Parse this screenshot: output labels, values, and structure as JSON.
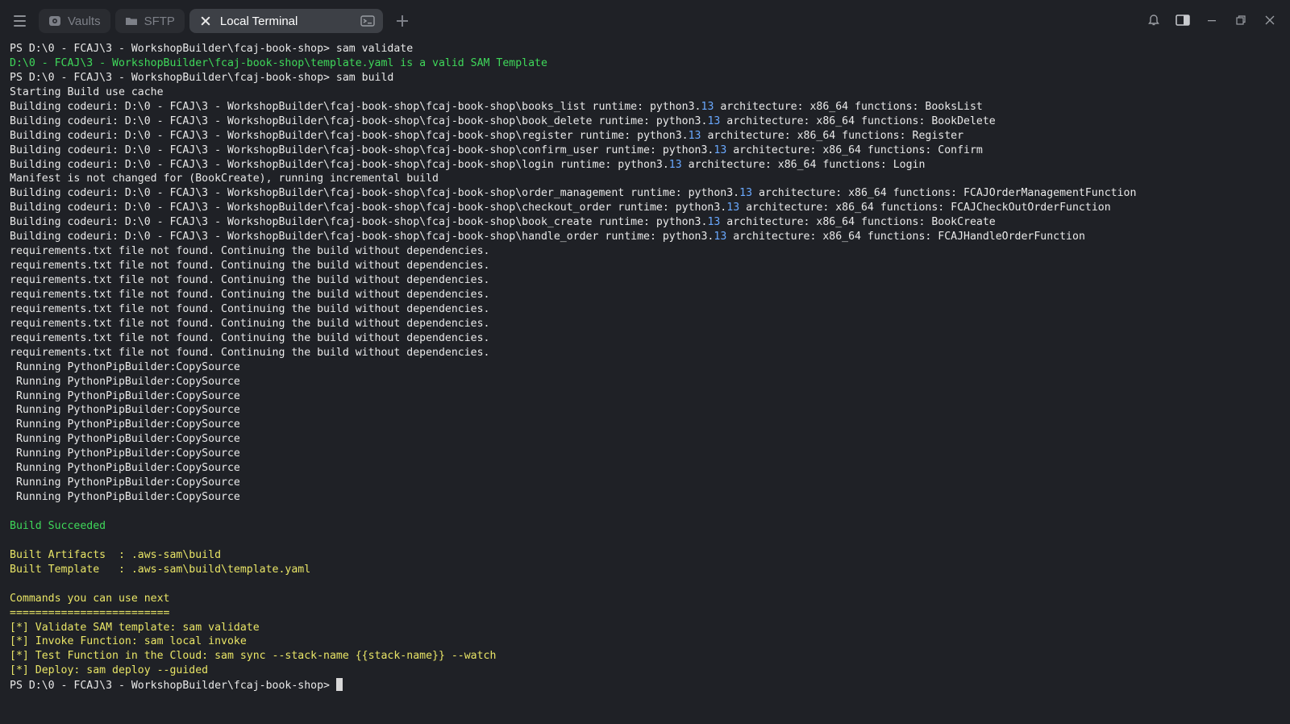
{
  "titlebar": {
    "tabs": [
      {
        "label": "Vaults",
        "icon": "vault-icon"
      },
      {
        "label": "SFTP",
        "icon": "folder-icon"
      },
      {
        "label": "Local Terminal",
        "icon": "terminal-icon",
        "active": true
      }
    ],
    "tools": [
      "bell-icon",
      "sidebar-toggle-icon",
      "minimize-icon",
      "restore-icon",
      "close-icon"
    ]
  },
  "colors": {
    "background": "#1f2126",
    "green": "#3fd85a",
    "yellow": "#e9e566",
    "number": "#6aa9ff"
  },
  "terminal": {
    "lines": [
      {
        "color": "default",
        "text": "PS D:\\0 - FCAJ\\3 - WorkshopBuilder\\fcaj-book-shop> sam validate"
      },
      {
        "color": "green",
        "text": "D:\\0 - FCAJ\\3 - WorkshopBuilder\\fcaj-book-shop\\template.yaml is a valid SAM Template"
      },
      {
        "color": "default",
        "text": "PS D:\\0 - FCAJ\\3 - WorkshopBuilder\\fcaj-book-shop> sam build"
      },
      {
        "color": "default",
        "text": "Starting Build use cache"
      },
      {
        "color": "default",
        "text": "Building codeuri: D:\\0 - FCAJ\\3 - WorkshopBuilder\\fcaj-book-shop\\fcaj-book-shop\\books_list runtime: python3.13 architecture: x86_64 functions: BooksList"
      },
      {
        "color": "default",
        "text": "Building codeuri: D:\\0 - FCAJ\\3 - WorkshopBuilder\\fcaj-book-shop\\fcaj-book-shop\\book_delete runtime: python3.13 architecture: x86_64 functions: BookDelete"
      },
      {
        "color": "default",
        "text": "Building codeuri: D:\\0 - FCAJ\\3 - WorkshopBuilder\\fcaj-book-shop\\fcaj-book-shop\\register runtime: python3.13 architecture: x86_64 functions: Register"
      },
      {
        "color": "default",
        "text": "Building codeuri: D:\\0 - FCAJ\\3 - WorkshopBuilder\\fcaj-book-shop\\fcaj-book-shop\\confirm_user runtime: python3.13 architecture: x86_64 functions: Confirm"
      },
      {
        "color": "default",
        "text": "Building codeuri: D:\\0 - FCAJ\\3 - WorkshopBuilder\\fcaj-book-shop\\fcaj-book-shop\\login runtime: python3.13 architecture: x86_64 functions: Login"
      },
      {
        "color": "default",
        "text": "Manifest is not changed for (BookCreate), running incremental build"
      },
      {
        "color": "default",
        "text": "Building codeuri: D:\\0 - FCAJ\\3 - WorkshopBuilder\\fcaj-book-shop\\fcaj-book-shop\\order_management runtime: python3.13 architecture: x86_64 functions: FCAJOrderManagementFunction"
      },
      {
        "color": "default",
        "text": "Building codeuri: D:\\0 - FCAJ\\3 - WorkshopBuilder\\fcaj-book-shop\\fcaj-book-shop\\checkout_order runtime: python3.13 architecture: x86_64 functions: FCAJCheckOutOrderFunction"
      },
      {
        "color": "default",
        "text": "Building codeuri: D:\\0 - FCAJ\\3 - WorkshopBuilder\\fcaj-book-shop\\fcaj-book-shop\\book_create runtime: python3.13 architecture: x86_64 functions: BookCreate"
      },
      {
        "color": "default",
        "text": "Building codeuri: D:\\0 - FCAJ\\3 - WorkshopBuilder\\fcaj-book-shop\\fcaj-book-shop\\handle_order runtime: python3.13 architecture: x86_64 functions: FCAJHandleOrderFunction"
      },
      {
        "color": "default",
        "text": "requirements.txt file not found. Continuing the build without dependencies."
      },
      {
        "color": "default",
        "text": "requirements.txt file not found. Continuing the build without dependencies."
      },
      {
        "color": "default",
        "text": "requirements.txt file not found. Continuing the build without dependencies."
      },
      {
        "color": "default",
        "text": "requirements.txt file not found. Continuing the build without dependencies."
      },
      {
        "color": "default",
        "text": "requirements.txt file not found. Continuing the build without dependencies."
      },
      {
        "color": "default",
        "text": "requirements.txt file not found. Continuing the build without dependencies."
      },
      {
        "color": "default",
        "text": "requirements.txt file not found. Continuing the build without dependencies."
      },
      {
        "color": "default",
        "text": "requirements.txt file not found. Continuing the build without dependencies."
      },
      {
        "color": "default",
        "text": " Running PythonPipBuilder:CopySource"
      },
      {
        "color": "default",
        "text": " Running PythonPipBuilder:CopySource"
      },
      {
        "color": "default",
        "text": " Running PythonPipBuilder:CopySource"
      },
      {
        "color": "default",
        "text": " Running PythonPipBuilder:CopySource"
      },
      {
        "color": "default",
        "text": " Running PythonPipBuilder:CopySource"
      },
      {
        "color": "default",
        "text": " Running PythonPipBuilder:CopySource"
      },
      {
        "color": "default",
        "text": " Running PythonPipBuilder:CopySource"
      },
      {
        "color": "default",
        "text": " Running PythonPipBuilder:CopySource"
      },
      {
        "color": "default",
        "text": " Running PythonPipBuilder:CopySource"
      },
      {
        "color": "default",
        "text": " Running PythonPipBuilder:CopySource"
      },
      {
        "color": "default",
        "text": ""
      },
      {
        "color": "green",
        "text": "Build Succeeded"
      },
      {
        "color": "default",
        "text": ""
      },
      {
        "color": "yellow",
        "text": "Built Artifacts  : .aws-sam\\build"
      },
      {
        "color": "yellow",
        "text": "Built Template   : .aws-sam\\build\\template.yaml"
      },
      {
        "color": "default",
        "text": ""
      },
      {
        "color": "yellow",
        "text": "Commands you can use next"
      },
      {
        "color": "yellow",
        "text": "========================="
      },
      {
        "color": "yellow",
        "text": "[*] Validate SAM template: sam validate"
      },
      {
        "color": "yellow",
        "text": "[*] Invoke Function: sam local invoke"
      },
      {
        "color": "yellow",
        "text": "[*] Test Function in the Cloud: sam sync --stack-name {{stack-name}} --watch"
      },
      {
        "color": "yellow",
        "text": "[*] Deploy: sam deploy --guided"
      }
    ],
    "prompt": "PS D:\\0 - FCAJ\\3 - WorkshopBuilder\\fcaj-book-shop> "
  }
}
